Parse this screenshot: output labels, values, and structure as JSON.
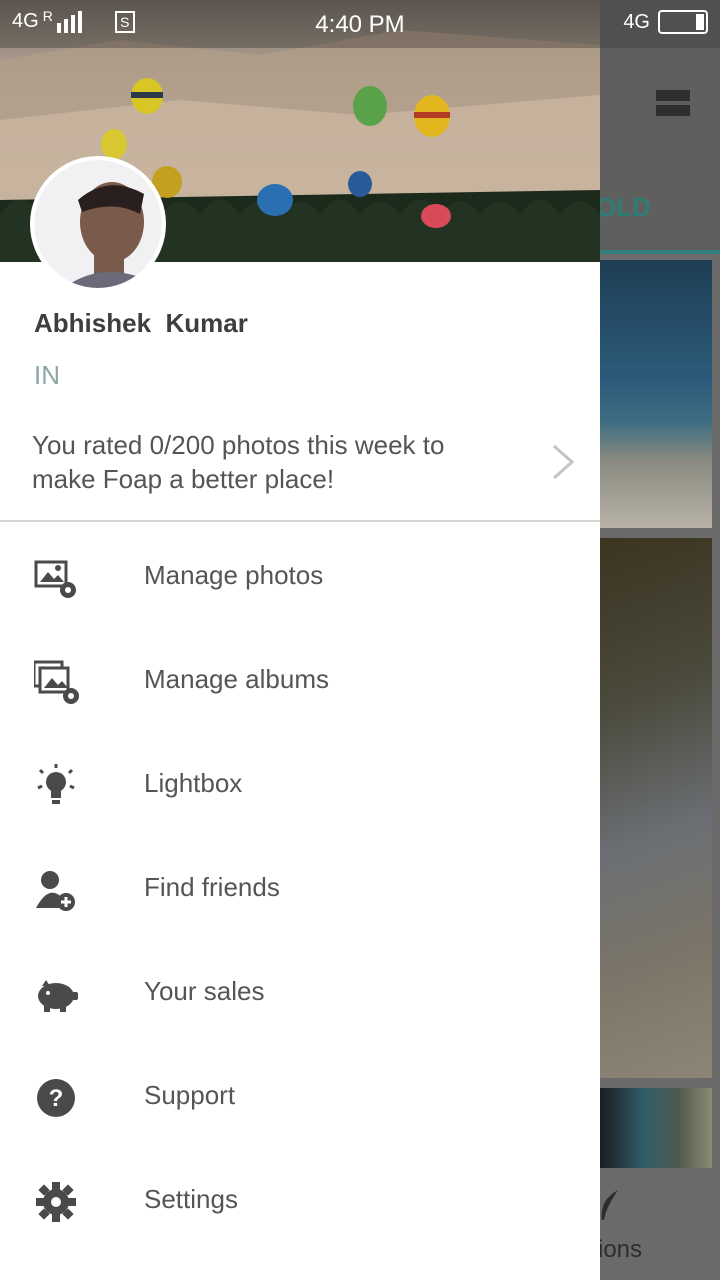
{
  "status_bar": {
    "network_left": "4G",
    "roaming": "R",
    "sim_icon": "S",
    "time": "4:40 PM",
    "network_right": "4G"
  },
  "profile": {
    "name": "Abhishek  Kumar",
    "country": "IN",
    "rating_message": "You rated 0/200 photos this week to make Foap a better place!"
  },
  "menu": [
    {
      "label": "Manage photos",
      "icon": "manage-photos-icon"
    },
    {
      "label": "Manage albums",
      "icon": "manage-albums-icon"
    },
    {
      "label": "Lightbox",
      "icon": "lightbulb-icon"
    },
    {
      "label": "Find friends",
      "icon": "add-friend-icon"
    },
    {
      "label": "Your sales",
      "icon": "piggy-bank-icon"
    },
    {
      "label": "Support",
      "icon": "help-icon"
    },
    {
      "label": "Settings",
      "icon": "gear-icon"
    }
  ],
  "background_app": {
    "tab_label_visible": "OLD",
    "bottom_label_visible": "ions"
  },
  "colors": {
    "accent": "#2e7c75",
    "text_primary": "#3e3e3e",
    "text_secondary": "#555555",
    "country_text": "#8ea6a5",
    "icon": "#4a4a4a"
  }
}
